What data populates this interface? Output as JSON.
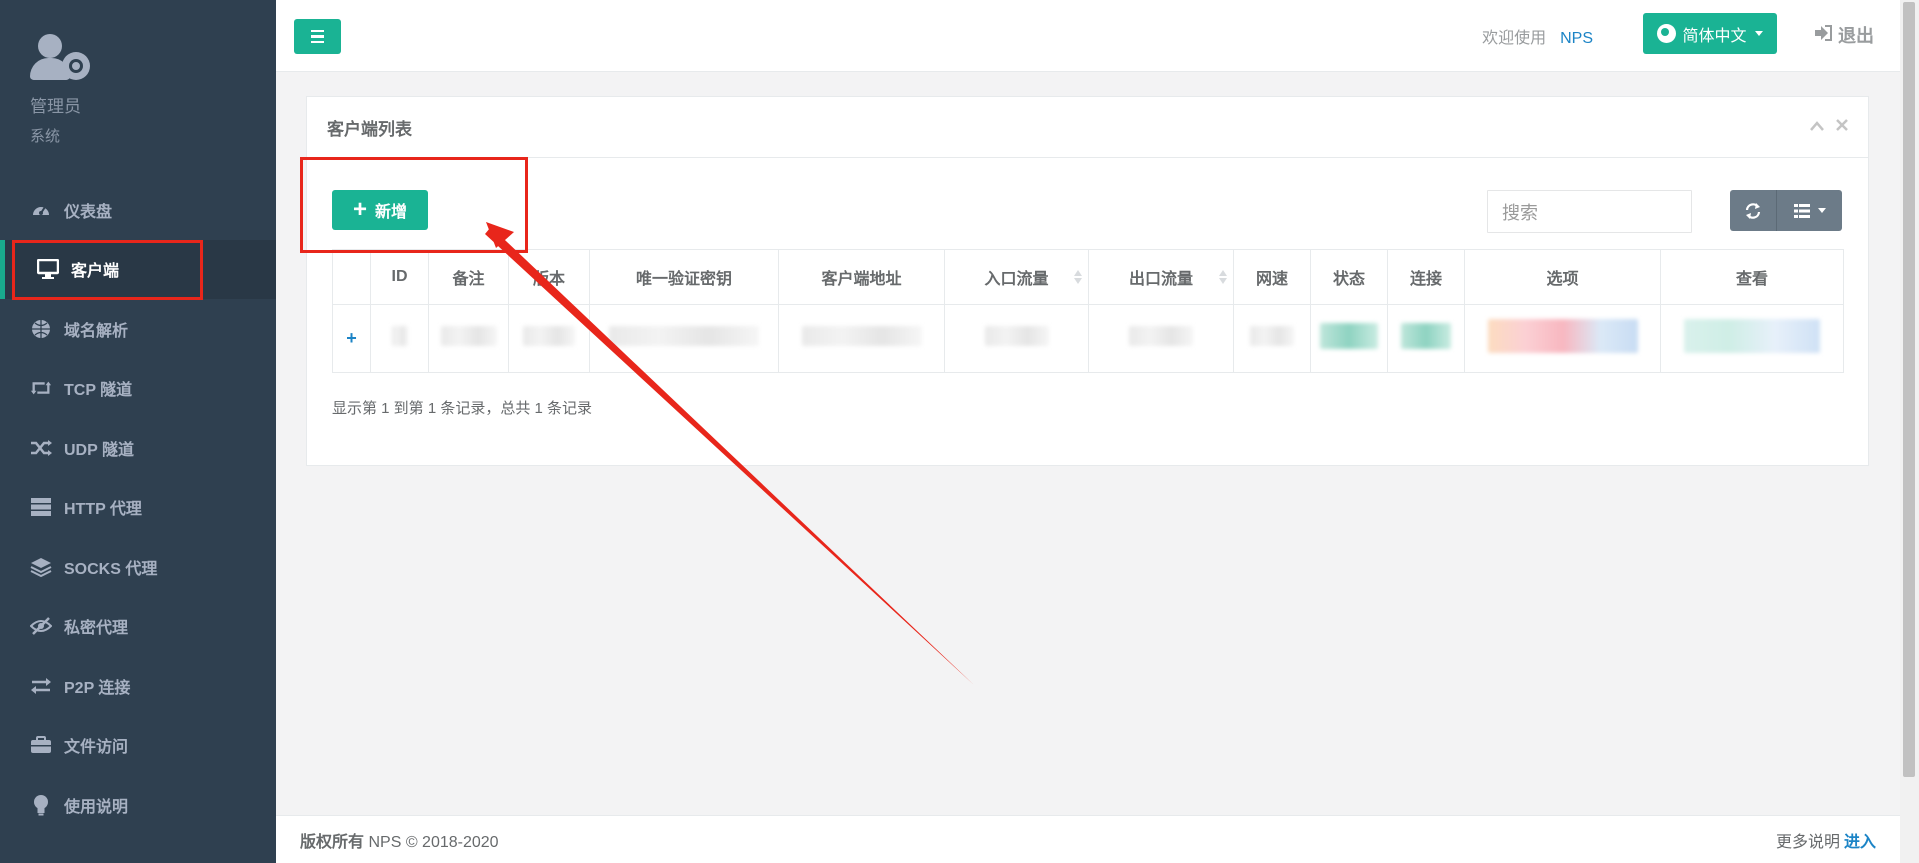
{
  "sidebar": {
    "profile": {
      "name": "管理员",
      "role": "系统"
    },
    "items": [
      {
        "label": "仪表盘",
        "icon": "dashboard-icon"
      },
      {
        "label": "客户端",
        "icon": "desktop-icon",
        "active": true
      },
      {
        "label": "域名解析",
        "icon": "globe-icon"
      },
      {
        "label": "TCP 隧道",
        "icon": "retweet-icon"
      },
      {
        "label": "UDP 隧道",
        "icon": "random-icon"
      },
      {
        "label": "HTTP 代理",
        "icon": "server-icon"
      },
      {
        "label": "SOCKS 代理",
        "icon": "layers-icon"
      },
      {
        "label": "私密代理",
        "icon": "eye-slash-icon"
      },
      {
        "label": "P2P 连接",
        "icon": "exchange-icon"
      },
      {
        "label": "文件访问",
        "icon": "briefcase-icon"
      },
      {
        "label": "使用说明",
        "icon": "lightbulb-icon"
      }
    ]
  },
  "topbar": {
    "welcome": "欢迎使用",
    "brand": "NPS",
    "language": "简体中文",
    "logout": "退出"
  },
  "panel": {
    "title": "客户端列表",
    "add_label": "新增",
    "search_placeholder": "搜索",
    "columns": [
      "ID",
      "备注",
      "版本",
      "唯一验证密钥",
      "客户端地址",
      "入口流量",
      "出口流量",
      "网速",
      "状态",
      "连接",
      "选项",
      "查看"
    ],
    "records_text": "显示第 1 到第 1 条记录，总共 1 条记录"
  },
  "footer": {
    "copyright_label": "版权所有",
    "copyright_text": "NPS © 2018-2020",
    "more_text": "更多说明",
    "enter_link": "进入"
  },
  "colors": {
    "sidebar_bg": "#2f4050",
    "accent": "#1ab394",
    "link": "#1c84c6",
    "annotation": "#e8261b"
  }
}
